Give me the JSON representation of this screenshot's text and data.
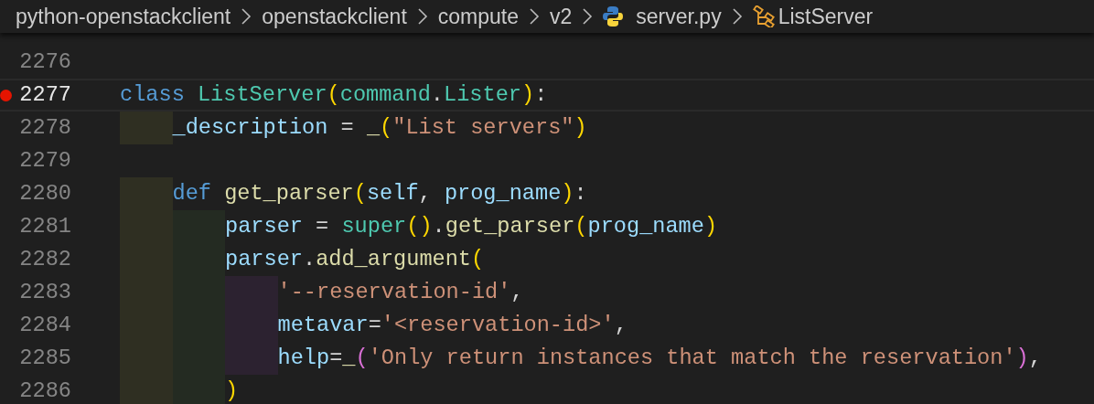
{
  "breadcrumb": [
    {
      "kind": "folder",
      "label": "python-openstackclient"
    },
    {
      "kind": "folder",
      "label": "openstackclient"
    },
    {
      "kind": "folder",
      "label": "compute"
    },
    {
      "kind": "folder",
      "label": "v2"
    },
    {
      "kind": "file",
      "label": "server.py"
    },
    {
      "kind": "symbol",
      "label": "ListServer"
    }
  ],
  "lines": [
    {
      "number": "2276",
      "current": false,
      "breakpoint": false
    },
    {
      "number": "2277",
      "current": true,
      "breakpoint": true,
      "tokens": [
        {
          "kind": "keyword",
          "text": "class "
        },
        {
          "kind": "type",
          "text": "ListServer"
        },
        {
          "kind": "bracket",
          "text": "("
        },
        {
          "kind": "type",
          "text": "command"
        },
        {
          "kind": "plain",
          "text": "."
        },
        {
          "kind": "type",
          "text": "Lister"
        },
        {
          "kind": "bracket",
          "text": ")"
        },
        {
          "kind": "plain",
          "text": ":"
        }
      ]
    },
    {
      "number": "2278",
      "current": false,
      "breakpoint": false,
      "guides": [
        {
          "color": "#2f2f22"
        }
      ],
      "tokens": [
        {
          "kind": "variable",
          "text": "_description"
        },
        {
          "kind": "plain",
          "text": " = "
        },
        {
          "kind": "function",
          "text": "_"
        },
        {
          "kind": "bracket",
          "text": "("
        },
        {
          "kind": "string",
          "text": "\"List servers\""
        },
        {
          "kind": "bracket",
          "text": ")"
        }
      ]
    },
    {
      "number": "2279",
      "current": false,
      "breakpoint": false
    },
    {
      "number": "2280",
      "current": false,
      "breakpoint": false,
      "guides": [
        {
          "color": "#2f2f22"
        }
      ],
      "tokens": [
        {
          "kind": "keyword",
          "text": "def "
        },
        {
          "kind": "function",
          "text": "get_parser"
        },
        {
          "kind": "bracket",
          "text": "("
        },
        {
          "kind": "variable",
          "text": "self"
        },
        {
          "kind": "plain",
          "text": ", "
        },
        {
          "kind": "variable",
          "text": "prog_name"
        },
        {
          "kind": "bracket",
          "text": ")"
        },
        {
          "kind": "plain",
          "text": ":"
        }
      ]
    },
    {
      "number": "2281",
      "current": false,
      "breakpoint": false,
      "guides": [
        {
          "color": "#2f2f22"
        },
        {
          "color": "#242b22"
        }
      ],
      "tokens": [
        {
          "kind": "variable",
          "text": "parser"
        },
        {
          "kind": "plain",
          "text": " = "
        },
        {
          "kind": "type",
          "text": "super"
        },
        {
          "kind": "bracket",
          "text": "()"
        },
        {
          "kind": "plain",
          "text": "."
        },
        {
          "kind": "function",
          "text": "get_parser"
        },
        {
          "kind": "bracket",
          "text": "("
        },
        {
          "kind": "variable",
          "text": "prog_name"
        },
        {
          "kind": "bracket",
          "text": ")"
        }
      ]
    },
    {
      "number": "2282",
      "current": false,
      "breakpoint": false,
      "guides": [
        {
          "color": "#2f2f22"
        },
        {
          "color": "#242b22"
        }
      ],
      "tokens": [
        {
          "kind": "variable",
          "text": "parser"
        },
        {
          "kind": "plain",
          "text": "."
        },
        {
          "kind": "function",
          "text": "add_argument"
        },
        {
          "kind": "bracket",
          "text": "("
        }
      ]
    },
    {
      "number": "2283",
      "current": false,
      "breakpoint": false,
      "guides": [
        {
          "color": "#2f2f22"
        },
        {
          "color": "#242b22"
        },
        {
          "color": "#2c2230"
        }
      ],
      "tokens": [
        {
          "kind": "string",
          "text": "'--reservation-id'"
        },
        {
          "kind": "plain",
          "text": ","
        }
      ]
    },
    {
      "number": "2284",
      "current": false,
      "breakpoint": false,
      "guides": [
        {
          "color": "#2f2f22"
        },
        {
          "color": "#242b22"
        },
        {
          "color": "#2c2230"
        }
      ],
      "tokens": [
        {
          "kind": "variable",
          "text": "metavar"
        },
        {
          "kind": "plain",
          "text": "="
        },
        {
          "kind": "string",
          "text": "'<reservation-id>'"
        },
        {
          "kind": "plain",
          "text": ","
        }
      ]
    },
    {
      "number": "2285",
      "current": false,
      "breakpoint": false,
      "guides": [
        {
          "color": "#2f2f22"
        },
        {
          "color": "#242b22"
        },
        {
          "color": "#2c2230"
        }
      ],
      "tokens": [
        {
          "kind": "variable",
          "text": "help"
        },
        {
          "kind": "plain",
          "text": "="
        },
        {
          "kind": "function",
          "text": "_"
        },
        {
          "kind": "bracket2",
          "text": "("
        },
        {
          "kind": "string",
          "text": "'Only return instances that match the reservation'"
        },
        {
          "kind": "bracket2",
          "text": ")"
        },
        {
          "kind": "plain",
          "text": ","
        }
      ]
    },
    {
      "number": "2286",
      "current": false,
      "breakpoint": false,
      "guides": [
        {
          "color": "#2f2f22"
        },
        {
          "color": "#242b22"
        }
      ],
      "tokens": [
        {
          "kind": "bracket",
          "text": ")"
        }
      ]
    }
  ]
}
